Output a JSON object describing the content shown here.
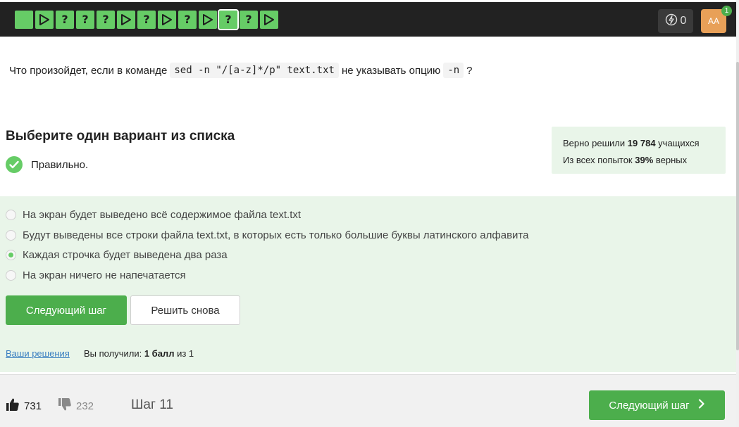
{
  "header": {
    "steps": [
      {
        "kind": "square"
      },
      {
        "kind": "play"
      },
      {
        "kind": "question",
        "glyph": "?"
      },
      {
        "kind": "question",
        "glyph": "?"
      },
      {
        "kind": "question",
        "glyph": "?"
      },
      {
        "kind": "play"
      },
      {
        "kind": "question",
        "glyph": "?"
      },
      {
        "kind": "play"
      },
      {
        "kind": "question",
        "glyph": "?"
      },
      {
        "kind": "play"
      },
      {
        "kind": "question",
        "glyph": "?",
        "active": true
      },
      {
        "kind": "question",
        "glyph": "?"
      },
      {
        "kind": "play"
      }
    ],
    "energy_count": "0",
    "avatar_initials": "AA",
    "notification_count": "1"
  },
  "question": {
    "prefix": "Что произойдет, если в команде",
    "command": "sed -n \"/[a-z]*/p\" text.txt",
    "middle": "не указывать опцию",
    "option": "-n",
    "suffix": "?"
  },
  "quiz": {
    "title": "Выберите один вариант из списка",
    "result_text": "Правильно."
  },
  "stats": {
    "line1_prefix": "Верно решили",
    "line1_count": "19 784",
    "line1_suffix": "учащихся",
    "line2_prefix": "Из всех попыток",
    "line2_percent": "39%",
    "line2_suffix": "верных"
  },
  "options": [
    {
      "label": "На экран будет выведено всё содержимое файла text.txt",
      "checked": false
    },
    {
      "label": "Будут выведены все строки файла text.txt, в которых есть только большие буквы латинского алфавита",
      "checked": false
    },
    {
      "label": "Каждая строчка будет выведена два раза",
      "checked": true
    },
    {
      "label": "На экран ничего не напечатается",
      "checked": false
    }
  ],
  "actions": {
    "next_label": "Следующий шаг",
    "retry_label": "Решить снова",
    "solutions_link": "Ваши решения",
    "score_prefix": "Вы получили:",
    "score_value": "1 балл",
    "score_suffix": "из 1"
  },
  "footer": {
    "likes": "731",
    "dislikes": "232",
    "step_label": "Шаг 11",
    "next_label": "Следующий шаг"
  },
  "colors": {
    "accent": "#4cae4c",
    "step_green": "#66cc66",
    "topbar": "#222222",
    "answers_bg": "#e9f5e9"
  }
}
